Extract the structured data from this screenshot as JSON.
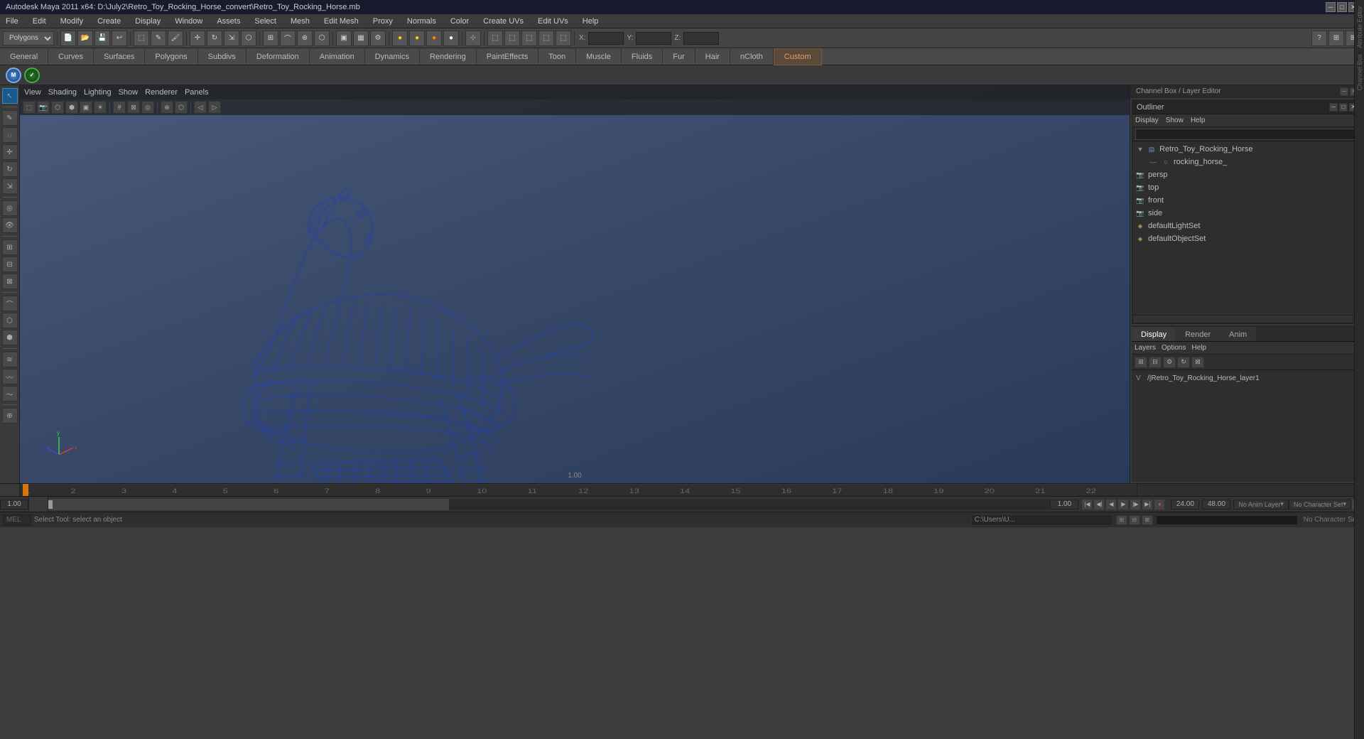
{
  "titleBar": {
    "title": "Autodesk Maya 2011 x64: D:\\July2\\Retro_Toy_Rocking_Horse_convert\\Retro_Toy_Rocking_Horse.mb",
    "minBtn": "─",
    "maxBtn": "□",
    "closeBtn": "✕"
  },
  "menuBar": {
    "items": [
      "File",
      "Edit",
      "Modify",
      "Create",
      "Display",
      "Window",
      "Assets",
      "Select",
      "Mesh",
      "Edit Mesh",
      "Proxy",
      "Normals",
      "Color",
      "Create UVs",
      "Edit UVs",
      "Help"
    ]
  },
  "modeDropdown": "Polygons",
  "tabs": {
    "items": [
      "General",
      "Curves",
      "Surfaces",
      "Polygons",
      "Subdivs",
      "Deformation",
      "Animation",
      "Dynamics",
      "Rendering",
      "PaintEffects",
      "Toon",
      "Muscle",
      "Fluids",
      "Fur",
      "Hair",
      "nCloth",
      "Custom"
    ]
  },
  "viewport": {
    "menuItems": [
      "View",
      "Shading",
      "Lighting",
      "Show",
      "Renderer",
      "Panels"
    ],
    "lightingLabel": "Lighting"
  },
  "outliner": {
    "title": "Outliner",
    "menuItems": [
      "Display",
      "Show",
      "Help"
    ],
    "treeItems": [
      {
        "id": "root",
        "label": "Retro_Toy_Rocking_Horse",
        "indent": 0,
        "type": "mesh",
        "expanded": true
      },
      {
        "id": "horse",
        "label": "rocking_horse_",
        "indent": 1,
        "type": "mesh"
      },
      {
        "id": "persp",
        "label": "persp",
        "indent": 0,
        "type": "cam"
      },
      {
        "id": "top",
        "label": "top",
        "indent": 0,
        "type": "cam"
      },
      {
        "id": "front",
        "label": "front",
        "indent": 0,
        "type": "cam"
      },
      {
        "id": "side",
        "label": "side",
        "indent": 0,
        "type": "cam"
      },
      {
        "id": "lightset",
        "label": "defaultLightSet",
        "indent": 0,
        "type": "set"
      },
      {
        "id": "objset",
        "label": "defaultObjectSet",
        "indent": 0,
        "type": "set"
      }
    ]
  },
  "channelBox": {
    "header": "Channel Box / Layer Editor"
  },
  "layerEditor": {
    "tabs": [
      "Display",
      "Render",
      "Anim"
    ],
    "subMenuItems": [
      "Layers",
      "Options",
      "Help"
    ],
    "layers": [
      {
        "v": "V",
        "name": "/|Retro_Toy_Rocking_Horse_layer1"
      }
    ]
  },
  "timeline": {
    "startFrame": "1.00",
    "endFrame": "24.00",
    "currentFrame": "1.00",
    "rangeStart": "1.00",
    "rangeEnd": "24.00",
    "endFrameFull": "48.00",
    "playbackSpeed": "",
    "noAnimLayer": "No Anim Layer",
    "noCharacterSet": "No Character Set"
  },
  "transport": {
    "buttons": [
      "⏮",
      "⏪",
      "◀",
      "▶",
      "▶▶",
      "⏭",
      "⏺"
    ]
  },
  "statusBar": {
    "mode": "MEL",
    "message": "Select Tool: select an object",
    "cmdField": "C:\\Users\\U...",
    "noCharSet": "No Character Set"
  },
  "sidebarStrip": {
    "labels": [
      "Channel Box",
      "Attribute Editor"
    ]
  },
  "axisLabels": {
    "x": "x",
    "y": "y",
    "z": "z"
  },
  "icons": {
    "mesh": "▤",
    "camera": "📷",
    "set": "◈",
    "arrow": "▶",
    "collapse": "▼",
    "check": "✓",
    "plus": "+",
    "minus": "−",
    "gear": "⚙",
    "folder": "📁",
    "save": "💾",
    "eye": "👁"
  }
}
